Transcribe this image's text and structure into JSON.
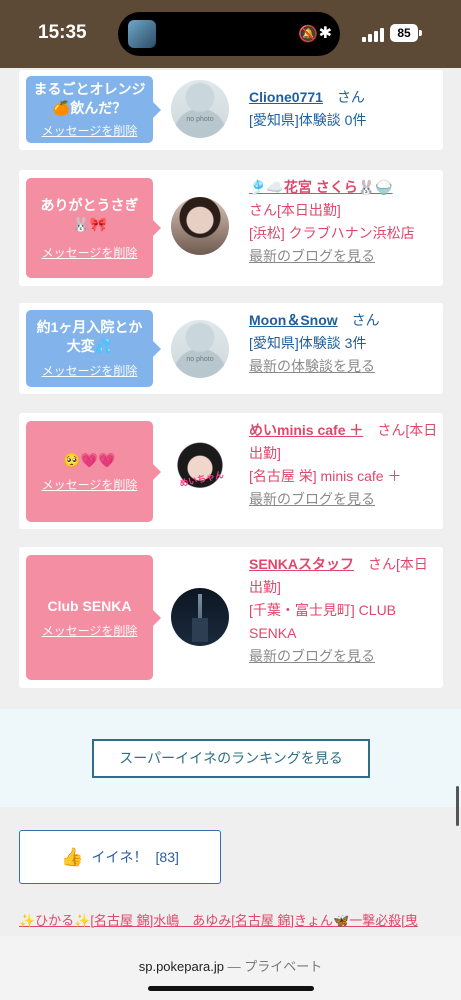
{
  "status_bar": {
    "time": "15:35",
    "battery": "85"
  },
  "cards": [
    {
      "message": "まるごとオレンジ🍊飲んだ？",
      "delete_label": "メッセージを削除",
      "avatar_text": "no photo",
      "name": "Clione0771",
      "san": "さん",
      "location": "[愛知県]体験談 0件",
      "link": ""
    },
    {
      "message": "ありがとうさぎ🐰🎀",
      "delete_label": "メッセージを削除",
      "name": "🎐☁️花宮 さくら🐰🍚",
      "san": "さん[本日出勤]",
      "location": "[浜松] クラブハナン浜松店",
      "link": "最新のブログを見る"
    },
    {
      "message": "約1ヶ月入院とか大変💦",
      "delete_label": "メッセージを削除",
      "avatar_text": "no photo",
      "name": "Moon＆Snow",
      "san": "さん",
      "location": "[愛知県]体験談 3件",
      "link": "最新の体験談を見る"
    },
    {
      "message": "🥺💗💗",
      "delete_label": "メッセージを削除",
      "avatar_text": "めいちゃん",
      "name": "めいminis cafe ＋",
      "san": "さん[本日出勤]",
      "location": "[名古屋 栄] minis cafe ＋",
      "link": "最新のブログを見る"
    },
    {
      "message": "Club SENKA",
      "delete_label": "メッセージを削除",
      "name": "SENKAスタッフ",
      "san": "さん[本日出勤]",
      "location": "[千葉・富士見町] CLUB SENKA",
      "link": "最新のブログを見る"
    }
  ],
  "ranking_button": "スーパーイイネのランキングを見る",
  "like_button": {
    "label": "イイネ！",
    "count": "[83]"
  },
  "likers_text": "✨ひかる✨[名古屋 錦]水嶋　あゆみ[名古屋 錦]きょん🦋一撃必殺[曳",
  "browser": {
    "url": "sp.pokepara.jp",
    "mode": "— プライベート"
  },
  "colors": {
    "blue_bubble": "#82b3ea",
    "pink_bubble": "#f48ea2",
    "link_blue": "#1f5f9e",
    "link_pink": "#e0476b"
  }
}
